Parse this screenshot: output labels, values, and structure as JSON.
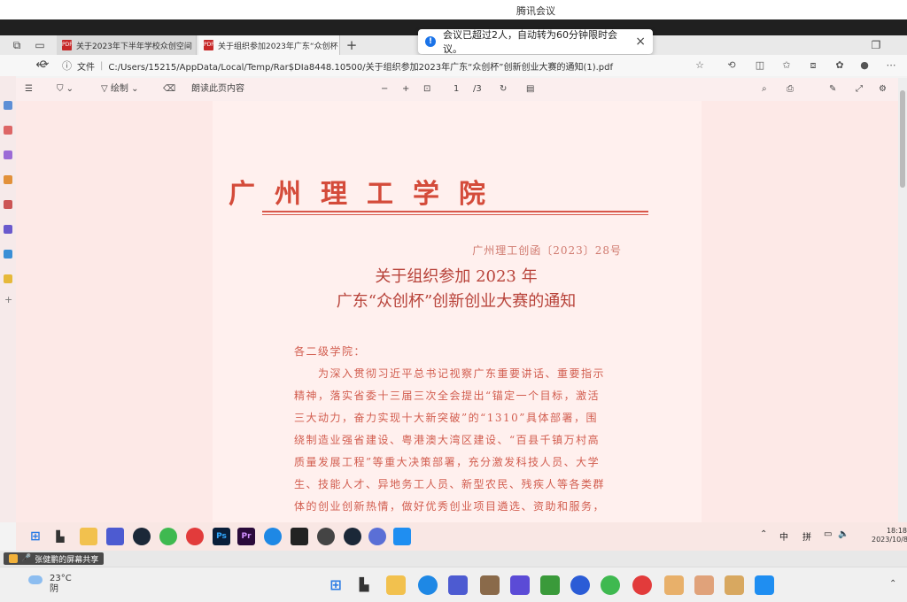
{
  "app_title": "腾讯会议",
  "tabs": [
    {
      "label": "关于2023年下半年学校众创空间"
    },
    {
      "label": "关于组织参加2023年广东“众创杯"
    }
  ],
  "notice": {
    "text": "会议已超过2人，自动转为60分钟限时会议。"
  },
  "address": {
    "file_label": "文件",
    "url": "C:/Users/15215/AppData/Local/Temp/Rar$DIa8448.10500/关于组织参加2023年广东“众创杯”创新创业大赛的通知(1).pdf"
  },
  "pdf_toolbar": {
    "draw_label": "绘制",
    "read_aloud_label": "朗读此页内容",
    "page_current": "1",
    "page_total": "/3"
  },
  "document": {
    "college": "广州理工学院",
    "doc_number": "广州理工创函〔2023〕28号",
    "headline_1": "关于组织参加 2023 年",
    "headline_2": "广东“众创杯”创新创业大赛的通知",
    "lines": [
      "各二级学院：",
      "　　为深入贯彻习近平总书记视察广东重要讲话、重要指示",
      "精神，落实省委十三届三次全会提出“锚定一个目标，激活",
      "三大动力，奋力实现十大新突破”的“1310”具体部署，围",
      "绕制造业强省建设、粤港澳大湾区建设、“百县千镇万村高",
      "质量发展工程”等重大决策部署，充分激发科技人员、大学",
      "生、技能人才、异地务工人员、新型农民、残疾人等各类群",
      "体的创业创新热情，做好优秀创业项目遴选、资助和服务，"
    ]
  },
  "inner_tray": {
    "input_mode": "中",
    "pinyin": "拼",
    "time": "18:18",
    "date": "2023/10/8"
  },
  "share": {
    "label": "张健鹏的屏幕共享"
  },
  "weather": {
    "temp": "23°C",
    "condition": "阴"
  },
  "colors": {
    "college_red": "#d44b3a",
    "pdf_bg": "#fde9e7",
    "notice_blue": "#1a73e8"
  }
}
